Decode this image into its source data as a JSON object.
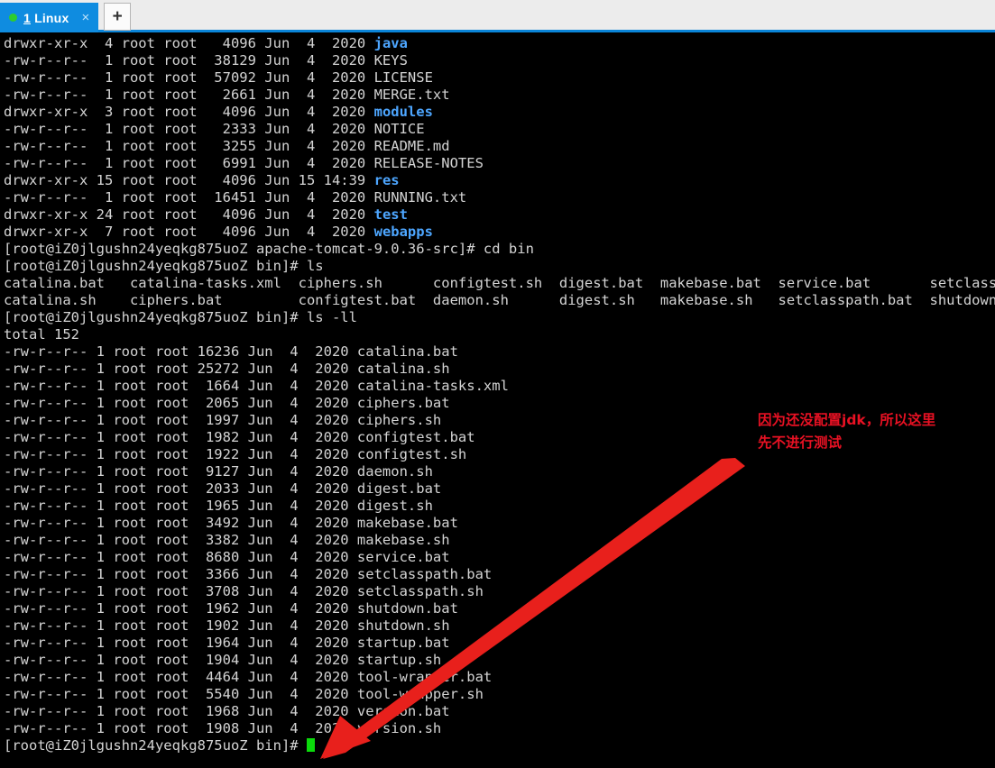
{
  "window": {
    "tabbar": {
      "tabs": [
        {
          "index": "1",
          "title": "Linux",
          "status_dot_color": "#2ecc2e",
          "close_glyph": "×"
        }
      ],
      "new_tab_glyph": "+",
      "active_tab_color": "#0f8ce0",
      "bar_background": "#ececec"
    }
  },
  "terminal": {
    "background": "#000000",
    "foreground": "#d4d4d4",
    "directory_color": "#4da6ff",
    "cursor_color": "#0bda0b",
    "lines": [
      "drwxr-xr-x  4 root root   4096 Jun  4  2020 ",
      "-rw-r--r--  1 root root  38129 Jun  4  2020 KEYS",
      "-rw-r--r--  1 root root  57092 Jun  4  2020 LICENSE",
      "-rw-r--r--  1 root root   2661 Jun  4  2020 MERGE.txt",
      "drwxr-xr-x  3 root root   4096 Jun  4  2020 ",
      "-rw-r--r--  1 root root   2333 Jun  4  2020 NOTICE",
      "-rw-r--r--  1 root root   3255 Jun  4  2020 README.md",
      "-rw-r--r--  1 root root   6991 Jun  4  2020 RELEASE-NOTES",
      "drwxr-xr-x 15 root root   4096 Jun 15 14:39 ",
      "-rw-r--r--  1 root root  16451 Jun  4  2020 RUNNING.txt",
      "drwxr-xr-x 24 root root   4096 Jun  4  2020 ",
      "drwxr-xr-x  7 root root   4096 Jun  4  2020 "
    ],
    "dir_names": {
      "java": "java",
      "modules": "modules",
      "res": "res",
      "test": "test",
      "webapps": "webapps"
    },
    "prompt_src": "[root@iZ0jlgushn24yeqkg875uoZ apache-tomcat-9.0.36-src]# ",
    "prompt_bin": "[root@iZ0jlgushn24yeqkg875uoZ bin]# ",
    "cmd_cd_bin": "cd bin",
    "cmd_ls": "ls",
    "cmd_ls_ll": "ls -ll",
    "ls_columns": [
      "catalina.bat   catalina-tasks.xml  ciphers.sh      configtest.sh  digest.bat  makebase.bat  service.bat       setclasspath.",
      "catalina.sh    ciphers.bat         configtest.bat  daemon.sh      digest.sh   makebase.sh   setclasspath.bat  shutdown.bat"
    ],
    "total_line": "total 152",
    "long_listing": [
      "-rw-r--r-- 1 root root 16236 Jun  4  2020 catalina.bat",
      "-rw-r--r-- 1 root root 25272 Jun  4  2020 catalina.sh",
      "-rw-r--r-- 1 root root  1664 Jun  4  2020 catalina-tasks.xml",
      "-rw-r--r-- 1 root root  2065 Jun  4  2020 ciphers.bat",
      "-rw-r--r-- 1 root root  1997 Jun  4  2020 ciphers.sh",
      "-rw-r--r-- 1 root root  1982 Jun  4  2020 configtest.bat",
      "-rw-r--r-- 1 root root  1922 Jun  4  2020 configtest.sh",
      "-rw-r--r-- 1 root root  9127 Jun  4  2020 daemon.sh",
      "-rw-r--r-- 1 root root  2033 Jun  4  2020 digest.bat",
      "-rw-r--r-- 1 root root  1965 Jun  4  2020 digest.sh",
      "-rw-r--r-- 1 root root  3492 Jun  4  2020 makebase.bat",
      "-rw-r--r-- 1 root root  3382 Jun  4  2020 makebase.sh",
      "-rw-r--r-- 1 root root  8680 Jun  4  2020 service.bat",
      "-rw-r--r-- 1 root root  3366 Jun  4  2020 setclasspath.bat",
      "-rw-r--r-- 1 root root  3708 Jun  4  2020 setclasspath.sh",
      "-rw-r--r-- 1 root root  1962 Jun  4  2020 shutdown.bat",
      "-rw-r--r-- 1 root root  1902 Jun  4  2020 shutdown.sh",
      "-rw-r--r-- 1 root root  1964 Jun  4  2020 startup.bat",
      "-rw-r--r-- 1 root root  1904 Jun  4  2020 startup.sh",
      "-rw-r--r-- 1 root root  4464 Jun  4  2020 tool-wrapper.bat",
      "-rw-r--r-- 1 root root  5540 Jun  4  2020 tool-wrapper.sh",
      "-rw-r--r-- 1 root root  1968 Jun  4  2020 version.bat",
      "-rw-r--r-- 1 root root  1908 Jun  4  2020 version.sh"
    ]
  },
  "annotation": {
    "text": "因为还没配置jdk，所以这里\n先不进行测试",
    "color": "#e81123",
    "arrow_color": "#e8201c"
  }
}
